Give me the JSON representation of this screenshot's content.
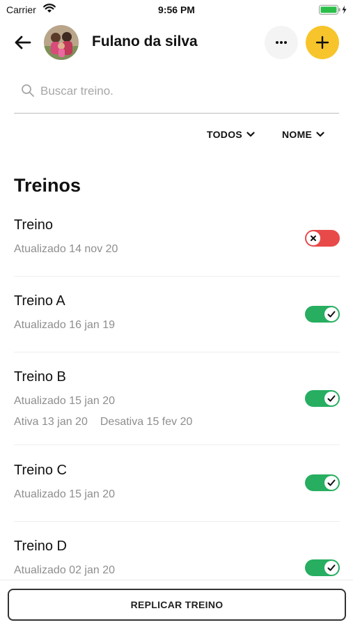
{
  "status_bar": {
    "carrier": "Carrier",
    "time": "9:56 PM",
    "icons": [
      "wifi-icon",
      "battery-icon",
      "charging-bolt-icon"
    ]
  },
  "header": {
    "back_icon": "arrow-left-icon",
    "title": "Fulano da silva",
    "more_icon": "ellipsis-icon",
    "add_icon": "plus-icon",
    "accent_color": "#f7c52b"
  },
  "search": {
    "placeholder": "Buscar treino.",
    "value": "",
    "icon": "search-icon"
  },
  "filters": {
    "status_label": "TODOS",
    "sort_label": "NOME",
    "icon": "chevron-down-icon"
  },
  "section": {
    "title": "Treinos"
  },
  "workouts": [
    {
      "name": "Treino",
      "updated": "Atualizado 14 nov 20",
      "active": false
    },
    {
      "name": "Treino A",
      "updated": "Atualizado 16 jan 19",
      "active": true
    },
    {
      "name": "Treino B",
      "updated": "Atualizado 15 jan 20",
      "active_from": "Ativa 13 jan 20",
      "active_until": "Desativa 15 fev 20",
      "active": true
    },
    {
      "name": "Treino C",
      "updated": "Atualizado 15 jan 20",
      "active": true
    },
    {
      "name": "Treino D",
      "updated": "Atualizado 02 jan 20",
      "active": true
    }
  ],
  "colors": {
    "toggle_on": "#27ae60",
    "toggle_off": "#e84a4a"
  },
  "footer": {
    "replicate_label": "REPLICAR TREINO"
  }
}
